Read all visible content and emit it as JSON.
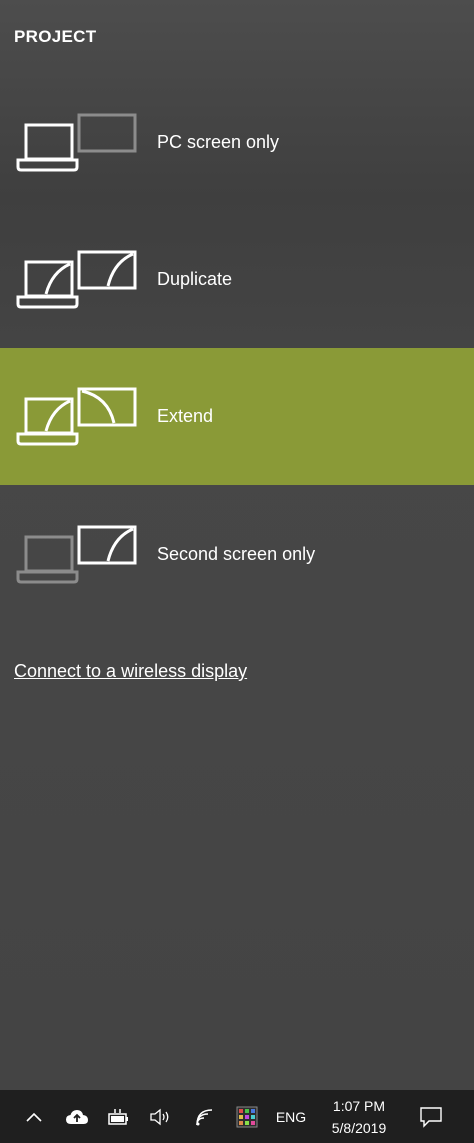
{
  "panel": {
    "title": "PROJECT",
    "options": [
      {
        "label": "PC screen only",
        "icon": "pc-screen-only-icon",
        "selected": false
      },
      {
        "label": "Duplicate",
        "icon": "duplicate-icon",
        "selected": false
      },
      {
        "label": "Extend",
        "icon": "extend-icon",
        "selected": true
      },
      {
        "label": "Second screen only",
        "icon": "second-screen-only-icon",
        "selected": false
      }
    ],
    "connect_link": "Connect to a wireless display"
  },
  "taskbar": {
    "language": "ENG",
    "time": "1:07 PM",
    "date": "5/8/2019",
    "icons": [
      "chevron-up-icon",
      "cloud-upload-icon",
      "battery-icon",
      "volume-icon",
      "wifi-icon",
      "app-tray-icon",
      "notification-icon"
    ]
  },
  "colors": {
    "accent": "#8a9a37",
    "panel_bg": "#474747",
    "taskbar_bg": "#1f1f1f",
    "dim_icon": "#8c8c8c"
  }
}
